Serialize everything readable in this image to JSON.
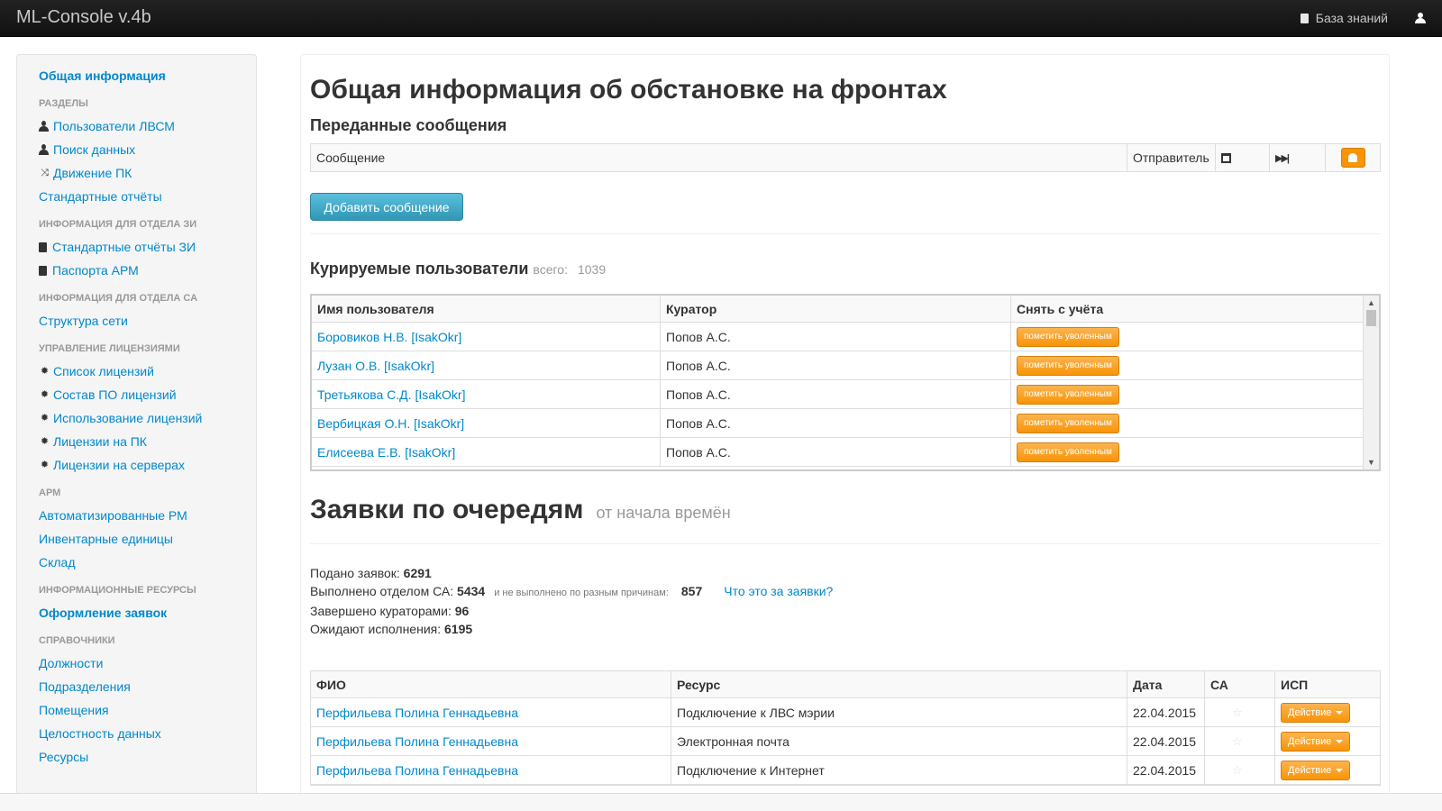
{
  "navbar": {
    "brand": "ML-Console v.4b",
    "knowledge_base": "База знаний"
  },
  "sidebar": {
    "top_item": "Общая информация",
    "sections": [
      {
        "header": "Разделы",
        "items": [
          {
            "icon": "user-icon",
            "label": "Пользователи ЛВСМ"
          },
          {
            "icon": "user-icon",
            "label": "Поиск данных"
          },
          {
            "icon": "shuffle-icon",
            "label": "Движение ПК"
          },
          {
            "icon": "",
            "label": "Стандартные отчёты"
          }
        ]
      },
      {
        "header": "Информация для отдела ЗИ",
        "items": [
          {
            "icon": "book-icon",
            "label": "Стандартные отчёты ЗИ"
          },
          {
            "icon": "book-icon",
            "label": "Паспорта АРМ"
          }
        ]
      },
      {
        "header": "Информация для отдела СА",
        "items": [
          {
            "icon": "",
            "label": "Структура сети"
          }
        ]
      },
      {
        "header": "Управление лицензиями",
        "items": [
          {
            "icon": "cog-icon",
            "label": "Список лицензий"
          },
          {
            "icon": "cog-icon",
            "label": "Состав ПО лицензий"
          },
          {
            "icon": "cog-icon",
            "label": "Использование лицензий"
          },
          {
            "icon": "cog-icon",
            "label": "Лицензии на ПК"
          },
          {
            "icon": "cog-icon",
            "label": "Лицензии на серверах"
          }
        ]
      },
      {
        "header": "АРМ",
        "items": [
          {
            "icon": "",
            "label": "Автоматизированные РМ"
          },
          {
            "icon": "",
            "label": "Инвентарные единицы"
          },
          {
            "icon": "",
            "label": "Склад"
          }
        ]
      },
      {
        "header": "Информационные ресурсы",
        "items": [
          {
            "icon": "",
            "label": "Оформление заявок",
            "active": true
          }
        ]
      },
      {
        "header": "Справочники",
        "items": [
          {
            "icon": "",
            "label": "Должности"
          },
          {
            "icon": "",
            "label": "Подразделения"
          },
          {
            "icon": "",
            "label": "Помещения"
          },
          {
            "icon": "",
            "label": "Целостность данных"
          },
          {
            "icon": "",
            "label": "Ресурсы"
          }
        ]
      }
    ]
  },
  "main": {
    "title": "Общая информация об обстановке на фронтах",
    "messages": {
      "title": "Переданные сообщения",
      "col_message": "Сообщение",
      "col_sender": "Отправитель",
      "add_button": "Добавить сообщение"
    },
    "users": {
      "title": "Курируемые пользователи",
      "total_label": "всего:",
      "total": "1039",
      "columns": [
        "Имя пользователя",
        "Куратор",
        "Снять с учёта"
      ],
      "button_label": "пометить уволенным",
      "rows": [
        {
          "name": "Боровиков Н.В. [IsakOkr]",
          "curator": "Попов А.С."
        },
        {
          "name": "Лузан О.В. [IsakOkr]",
          "curator": "Попов А.С."
        },
        {
          "name": "Третьякова С.Д. [IsakOkr]",
          "curator": "Попов А.С."
        },
        {
          "name": "Вербицкая О.Н. [IsakOkr]",
          "curator": "Попов А.С."
        },
        {
          "name": "Елисеева Е.В. [IsakOkr]",
          "curator": "Попов А.С."
        }
      ]
    },
    "queues": {
      "title": "Заявки по очередям",
      "subtitle": "от начала времён",
      "submitted_label": "Подано заявок:",
      "submitted": "6291",
      "done_label": "Выполнено отделом СА:",
      "done": "5434",
      "not_done_label": "и не выполнено по разным причинам:",
      "not_done": "857",
      "what_link": "Что это за заявки?",
      "curated_label": "Завершено кураторами:",
      "curated": "96",
      "waiting_label": "Ожидают исполнения:",
      "waiting": "6195"
    },
    "requests": {
      "columns": [
        "ФИО",
        "Ресурс",
        "Дата",
        "СА",
        "ИСП"
      ],
      "action_label": "Действие",
      "rows": [
        {
          "fio": "Перфильева Полина Геннадьевна",
          "resource": "Подключение к ЛВС мэрии",
          "date": "22.04.2015"
        },
        {
          "fio": "Перфильева Полина Геннадьевна",
          "resource": "Электронная почта",
          "date": "22.04.2015"
        },
        {
          "fio": "Перфильева Полина Геннадьевна",
          "resource": "Подключение к Интернет",
          "date": "22.04.2015"
        }
      ]
    }
  },
  "colors": {
    "accent": "#0088cc",
    "warning": "#f89406",
    "info": "#2f96b4",
    "navbar": "#1b1b1b"
  }
}
